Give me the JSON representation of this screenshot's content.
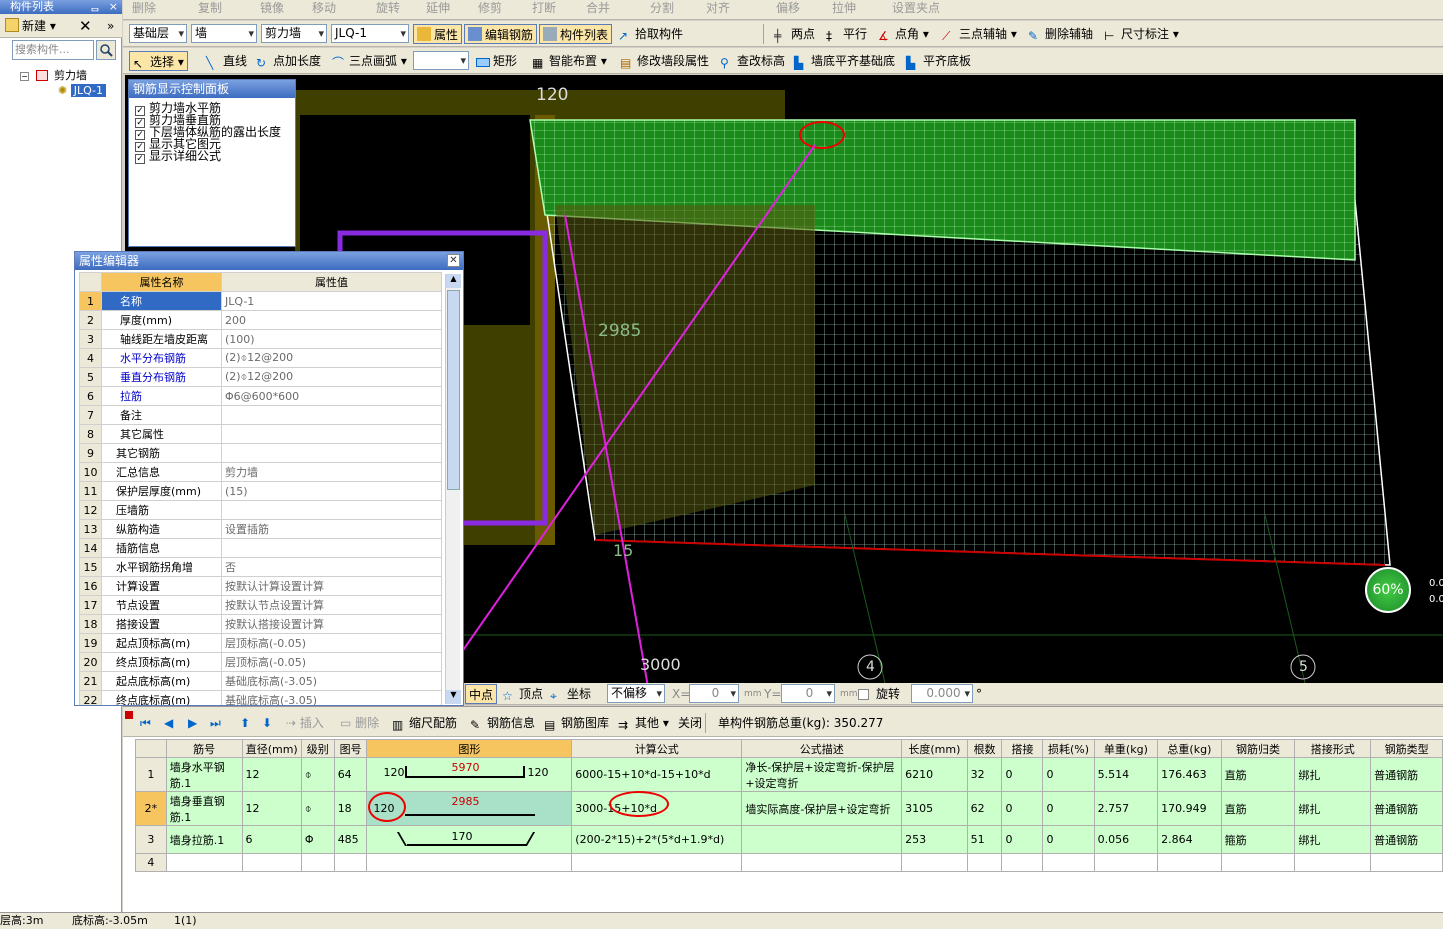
{
  "component_list": {
    "title": "构件列表",
    "pin": "ﾂ",
    "close": "×",
    "new_label": "新建",
    "delete_icon_label": "✕",
    "more": "»",
    "search_placeholder": "搜索构件...",
    "tree_root": "剪力墙",
    "tree_child": "JLQ-1"
  },
  "toolbar1": {
    "items": [
      "删除",
      "复制",
      "镜像",
      "移动",
      "旋转",
      "延伸",
      "修剪",
      "打断",
      "合并",
      "分割",
      "对齐",
      "偏移",
      "拉伸",
      "设置夹点"
    ]
  },
  "toolbar2": {
    "layer": "基础层",
    "type": "墙",
    "subtype": "剪力墙",
    "component": "JLQ-1",
    "buttons": [
      "属性",
      "编辑钢筋",
      "构件列表",
      "拾取构件"
    ],
    "right": [
      "两点",
      "平行",
      "点角",
      "三点辅轴",
      "删除辅轴",
      "尺寸标注"
    ]
  },
  "toolbar3": {
    "select": "选择",
    "line": "直线",
    "point_length": "点加长度",
    "arc": "三点画弧",
    "rect": "矩形",
    "smart": "智能布置",
    "modify": "修改墙段属性",
    "check_elev": "查改标高",
    "align_base": "墙底平齐基础底",
    "align_slab": "平齐底板"
  },
  "rebar_panel": {
    "title": "钢筋显示控制面板",
    "options": [
      "剪力墙水平筋",
      "剪力墙垂直筋",
      "下层墙体纵筋的露出长度",
      "显示其它图元",
      "显示详细公式"
    ]
  },
  "prop_editor": {
    "title": "属性编辑器",
    "col_name": "属性名称",
    "col_value": "属性值",
    "rows": [
      {
        "n": "1",
        "name": "名称",
        "value": "JLQ-1",
        "blue": true
      },
      {
        "n": "2",
        "name": "厚度(mm)",
        "value": "200"
      },
      {
        "n": "3",
        "name": "轴线距左墙皮距离",
        "value": "(100)"
      },
      {
        "n": "4",
        "name": "水平分布钢筋",
        "value": "(2)⌽12@200",
        "blue": true
      },
      {
        "n": "5",
        "name": "垂直分布钢筋",
        "value": "(2)⌽12@200",
        "blue": true
      },
      {
        "n": "6",
        "name": "拉筋",
        "value": "Φ6@600*600",
        "blue": true
      },
      {
        "n": "7",
        "name": "备注",
        "value": ""
      },
      {
        "n": "8",
        "name": "其它属性",
        "value": ""
      },
      {
        "n": "9",
        "name": "其它钢筋",
        "value": ""
      },
      {
        "n": "10",
        "name": "汇总信息",
        "value": "剪力墙"
      },
      {
        "n": "11",
        "name": "保护层厚度(mm)",
        "value": "(15)"
      },
      {
        "n": "12",
        "name": "压墙筋",
        "value": ""
      },
      {
        "n": "13",
        "name": "纵筋构造",
        "value": "设置插筋"
      },
      {
        "n": "14",
        "name": "插筋信息",
        "value": ""
      },
      {
        "n": "15",
        "name": "水平钢筋拐角增",
        "value": "否"
      },
      {
        "n": "16",
        "name": "计算设置",
        "value": "按默认计算设置计算"
      },
      {
        "n": "17",
        "name": "节点设置",
        "value": "按默认节点设置计算"
      },
      {
        "n": "18",
        "name": "搭接设置",
        "value": "按默认搭接设置计算"
      },
      {
        "n": "19",
        "name": "起点顶标高(m)",
        "value": "层顶标高(-0.05)"
      },
      {
        "n": "20",
        "name": "终点顶标高(m)",
        "value": "层顶标高(-0.05)"
      },
      {
        "n": "21",
        "name": "起点底标高(m)",
        "value": "基础底标高(-3.05)"
      },
      {
        "n": "22",
        "name": "终点底标高(m)",
        "value": "基础底标高(-3.05)"
      }
    ]
  },
  "viewport": {
    "label_120": "120",
    "label_2985": "2985",
    "label_15": "15",
    "label_3000": "3000",
    "axis4": "4",
    "axis5": "5",
    "zoom": "60%",
    "zoom_a": "0.0",
    "zoom_b": "0.0"
  },
  "snapbar": {
    "midpoint": "中点",
    "vertex": "顶点",
    "coord": "坐标",
    "offset": "不偏移",
    "x_label": "X=",
    "x_val": "0",
    "mm1": "mm",
    "y_label": "Y=",
    "y_val": "0",
    "mm2": "mm",
    "rotate": "旋转",
    "rotate_val": "0.000",
    "deg": "°"
  },
  "rebar_toolbar": {
    "insert": "插入",
    "delete": "删除",
    "scale": "缩尺配筋",
    "info": "钢筋信息",
    "library": "钢筋图库",
    "other": "其他",
    "close": "关闭",
    "total": "单构件钢筋总重(kg): 350.277"
  },
  "rebar_table": {
    "headers": [
      "",
      "筋号",
      "直径(mm)",
      "级别",
      "图号",
      "图形",
      "计算公式",
      "公式描述",
      "长度(mm)",
      "根数",
      "搭接",
      "损耗(%)",
      "单重(kg)",
      "总重(kg)",
      "钢筋归类",
      "搭接形式",
      "钢筋类型"
    ],
    "rows": [
      {
        "idx": "1",
        "name": "墙身水平钢筋.1",
        "dia": "12",
        "grade": "⌽",
        "fig": "64",
        "shape_l": "120",
        "shape_m": "5970",
        "shape_r": "120",
        "formula": "6000-15+10*d-15+10*d",
        "desc": "净长-保护层+设定弯折-保护层+设定弯折",
        "len": "6210",
        "cnt": "32",
        "lap": "0",
        "loss": "0",
        "unit": "5.514",
        "total": "176.463",
        "cls": "直筋",
        "lap_type": "绑扎",
        "type": "普通钢筋"
      },
      {
        "idx": "2*",
        "name": "墙身垂直钢筋.1",
        "dia": "12",
        "grade": "⌽",
        "fig": "18",
        "shape_l": "120",
        "shape_m": "2985",
        "shape_r": "",
        "formula": "3000-15+10*d",
        "desc": "墙实际高度-保护层+设定弯折",
        "len": "3105",
        "cnt": "62",
        "lap": "0",
        "loss": "0",
        "unit": "2.757",
        "total": "170.949",
        "cls": "直筋",
        "lap_type": "绑扎",
        "type": "普通钢筋"
      },
      {
        "idx": "3",
        "name": "墙身拉筋.1",
        "dia": "6",
        "grade": "Φ",
        "fig": "485",
        "shape_l": "",
        "shape_m": "170",
        "shape_r": "",
        "formula": "(200-2*15)+2*(5*d+1.9*d)",
        "desc": "",
        "len": "253",
        "cnt": "51",
        "lap": "0",
        "loss": "0",
        "unit": "0.056",
        "total": "2.864",
        "cls": "箍筋",
        "lap_type": "绑扎",
        "type": "普通钢筋"
      },
      {
        "idx": "4",
        "name": "",
        "dia": "",
        "grade": "",
        "fig": "",
        "shape_l": "",
        "shape_m": "",
        "shape_r": "",
        "formula": "",
        "desc": "",
        "len": "",
        "cnt": "",
        "lap": "",
        "loss": "",
        "unit": "",
        "total": "",
        "cls": "",
        "lap_type": "",
        "type": ""
      }
    ]
  },
  "statusbar": {
    "height": "层高:3m",
    "bottom": "底标高:-3.05m",
    "count": "1(1)"
  }
}
